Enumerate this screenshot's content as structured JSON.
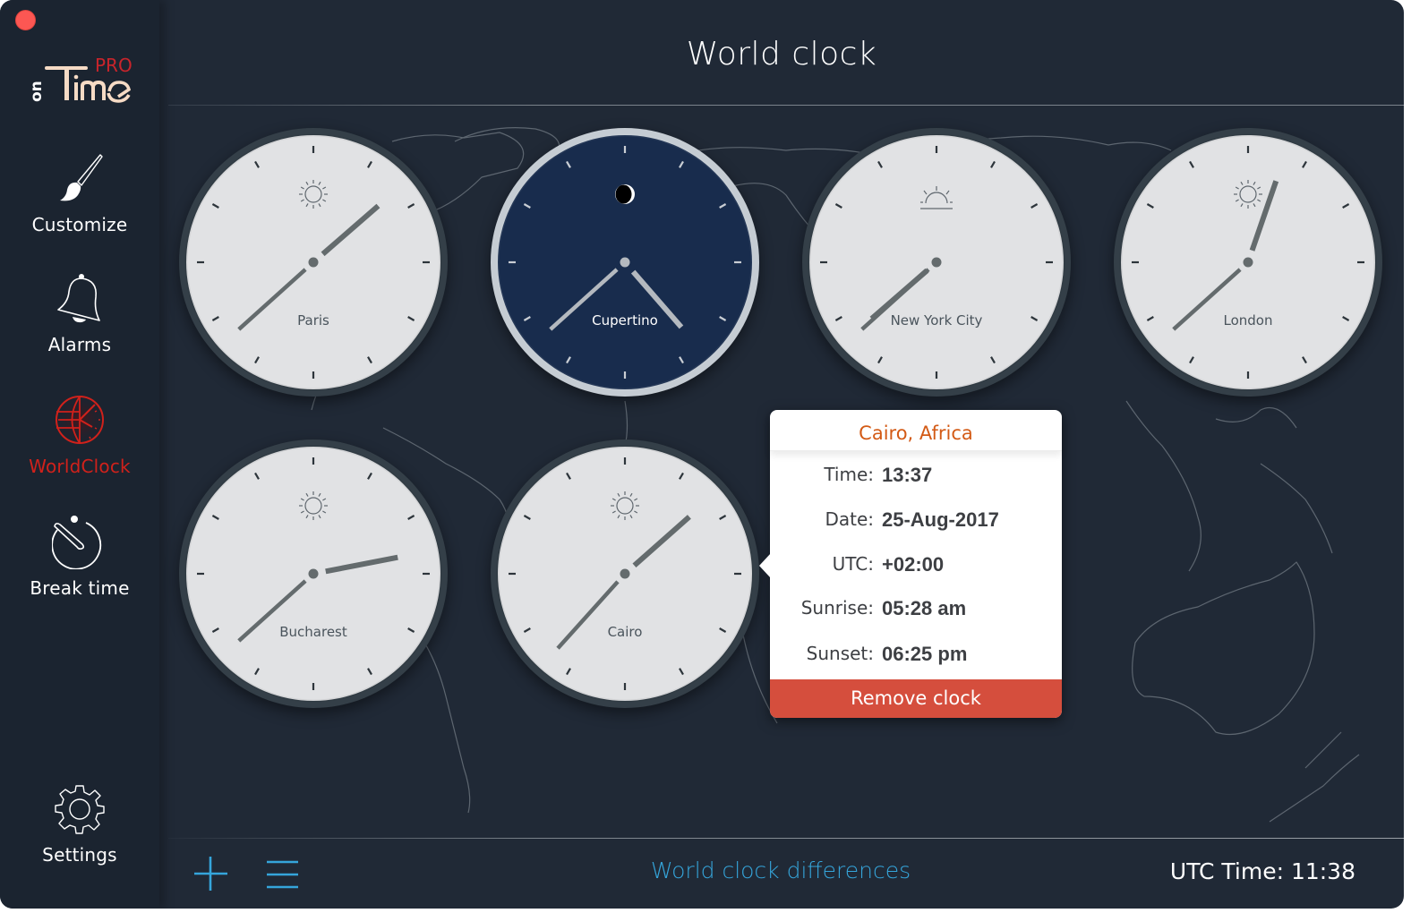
{
  "app": {
    "logo_main": "onTime",
    "logo_badge": "PRO",
    "accent_active": "#d0211b",
    "link_color": "#35a5db"
  },
  "sidebar": {
    "items": [
      {
        "id": "customize",
        "label": "Customize",
        "icon": "paintbrush-icon"
      },
      {
        "id": "alarms",
        "label": "Alarms",
        "icon": "bell-icon"
      },
      {
        "id": "worldclock",
        "label": "WorldClock",
        "icon": "globe-clock-icon",
        "active": true
      },
      {
        "id": "break-time",
        "label": "Break time",
        "icon": "stopwatch-icon"
      },
      {
        "id": "settings",
        "label": "Settings",
        "icon": "gear-icon"
      }
    ]
  },
  "header": {
    "title": "World clock"
  },
  "clocks": [
    {
      "city": "Paris",
      "time": "13:38",
      "hour": 13,
      "minute": 38,
      "status_icon": "sun-icon",
      "night": false
    },
    {
      "city": "Cupertino",
      "time": "04:38",
      "hour": 4,
      "minute": 38,
      "status_icon": "moon-icon",
      "night": true
    },
    {
      "city": "New York City",
      "time": "07:38",
      "hour": 7,
      "minute": 38,
      "status_icon": "sunrise-icon",
      "night": false
    },
    {
      "city": "London",
      "time": "12:38",
      "hour": 12,
      "minute": 38,
      "status_icon": "sun-icon",
      "night": false
    },
    {
      "city": "Bucharest",
      "time": "14:38",
      "hour": 14,
      "minute": 38,
      "status_icon": "sun-icon",
      "night": false
    },
    {
      "city": "Cairo",
      "time": "13:37",
      "hour": 13,
      "minute": 37,
      "status_icon": "sun-icon",
      "night": false
    }
  ],
  "popover": {
    "title": "Cairo, Africa",
    "rows": [
      {
        "label": "Time:",
        "value": "13:37"
      },
      {
        "label": "Date:",
        "value": "25-Aug-2017"
      },
      {
        "label": "UTC:",
        "value": "+02:00"
      },
      {
        "label": "Sunrise:",
        "value": "05:28 am"
      },
      {
        "label": "Sunset:",
        "value": "06:25 pm"
      }
    ],
    "remove_label": "Remove clock"
  },
  "footer": {
    "add_icon": "plus-icon",
    "list_icon": "list-icon",
    "differences_link": "World clock differences",
    "utc_time": "UTC Time: 11:38"
  }
}
